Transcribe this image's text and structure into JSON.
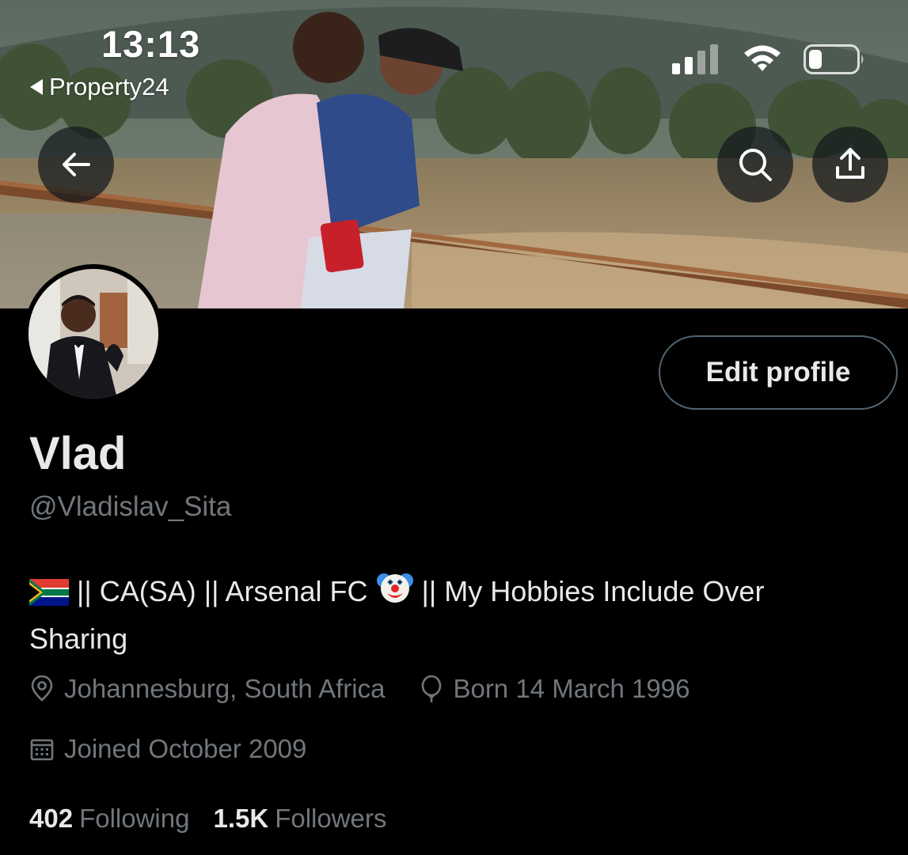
{
  "status_bar": {
    "time": "13:13",
    "back_app": "Property24"
  },
  "nav": {
    "back_icon": "arrow-left-icon",
    "search_icon": "search-icon",
    "share_icon": "share-icon"
  },
  "profile": {
    "edit_label": "Edit profile",
    "display_name": "Vlad",
    "handle": "@Vladislav_Sita",
    "bio_before_emoji": "|| CA(SA) || Arsenal FC",
    "bio_after_emoji": "|| My Hobbies Include Over Sharing",
    "location": "Johannesburg, South Africa",
    "born": "Born 14 March 1996",
    "joined": "Joined October 2009",
    "following_count": "402",
    "following_label": "Following",
    "followers_count": "1.5K",
    "followers_label": "Followers"
  },
  "colors": {
    "background": "#000000",
    "primary_text": "#e7e9ea",
    "secondary_text": "#71767b",
    "button_border": "#536471"
  }
}
